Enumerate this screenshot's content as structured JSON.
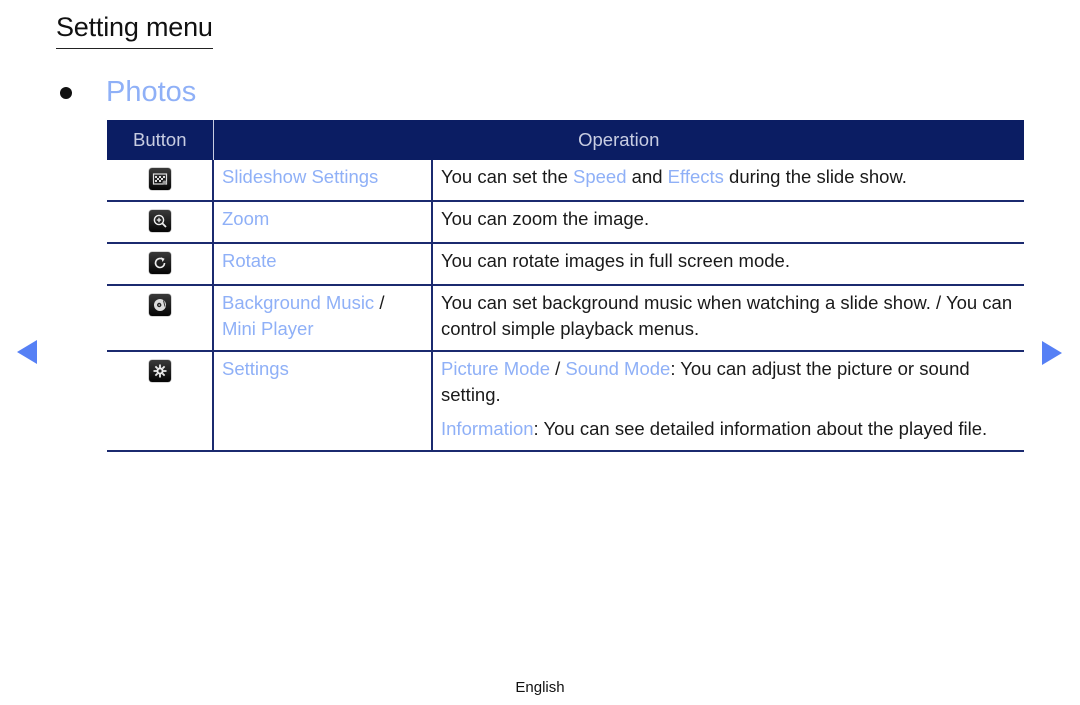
{
  "page": {
    "title": "Setting menu",
    "section_title": "Photos",
    "footer_language": "English",
    "accent_color": "#8fb0f7",
    "header_bg_color": "#0b1d63",
    "nav_arrow_color": "#5680f5"
  },
  "table": {
    "headers": {
      "button": "Button",
      "operation": "Operation"
    },
    "rows": [
      {
        "icon": "slideshow-settings-icon",
        "name": "Slideshow Settings",
        "desc": [
          [
            {
              "t": "You can set the ",
              "hl": false
            },
            {
              "t": "Speed",
              "hl": true
            },
            {
              "t": " and ",
              "hl": false
            },
            {
              "t": "Effects",
              "hl": true
            },
            {
              "t": " during the slide show.",
              "hl": false
            }
          ]
        ]
      },
      {
        "icon": "zoom-icon",
        "name": "Zoom",
        "desc": [
          [
            {
              "t": "You can zoom the image.",
              "hl": false
            }
          ]
        ]
      },
      {
        "icon": "rotate-icon",
        "name": "Rotate",
        "desc": [
          [
            {
              "t": "You can rotate images in full screen mode.",
              "hl": false
            }
          ]
        ]
      },
      {
        "icon": "background-music-icon",
        "name_parts": [
          {
            "t": "Background Music",
            "hl": true
          },
          {
            "t": " / ",
            "hl": false
          },
          {
            "t": "Mini Player",
            "hl": true
          }
        ],
        "desc": [
          [
            {
              "t": "You can set background music when watching a slide show. / You can control simple playback menus.",
              "hl": false
            }
          ]
        ]
      },
      {
        "icon": "settings-gear-icon",
        "name": "Settings",
        "desc": [
          [
            {
              "t": "Picture Mode",
              "hl": true
            },
            {
              "t": " / ",
              "hl": false
            },
            {
              "t": "Sound Mode",
              "hl": true
            },
            {
              "t": ": You can adjust the picture or sound setting.",
              "hl": false
            }
          ],
          [
            {
              "t": "Information",
              "hl": true
            },
            {
              "t": ": You can see detailed information about the played file.",
              "hl": false
            }
          ]
        ]
      }
    ]
  },
  "navigation": {
    "prev_icon": "triangle-left-icon",
    "next_icon": "triangle-right-icon"
  }
}
